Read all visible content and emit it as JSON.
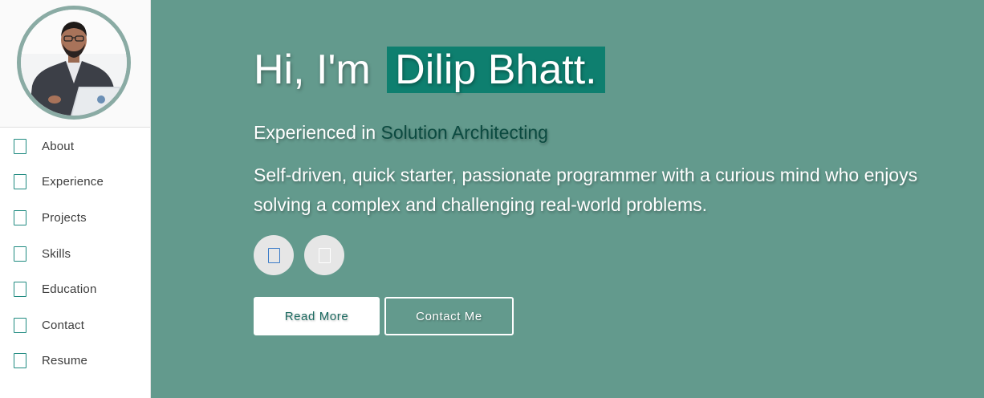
{
  "sidebar": {
    "avatar_alt": "Dilip Bhatt profile photo",
    "items": [
      {
        "label": "About",
        "icon": "about-icon"
      },
      {
        "label": "Experience",
        "icon": "experience-icon"
      },
      {
        "label": "Projects",
        "icon": "projects-icon"
      },
      {
        "label": "Skills",
        "icon": "skills-icon"
      },
      {
        "label": "Education",
        "icon": "education-icon"
      },
      {
        "label": "Contact",
        "icon": "contact-icon"
      },
      {
        "label": "Resume",
        "icon": "resume-icon"
      }
    ]
  },
  "hero": {
    "greeting": "Hi, I'm",
    "name": "Dilip Bhatt.",
    "experience_prefix": "Experienced in",
    "experience_role": "Solution Architecting",
    "bio": "Self-driven, quick starter, passionate programmer with a curious mind who enjoys solving a complex and challenging real-world problems.",
    "socials": [
      {
        "icon": "linkedin-icon"
      },
      {
        "icon": "github-icon"
      }
    ],
    "read_more_label": "Read More",
    "contact_me_label": "Contact Me"
  },
  "colors": {
    "hero_background": "#639a8d",
    "name_highlight": "#0e7f6f",
    "role_text": "#0b4a40",
    "nav_icon": "#1f8a80"
  }
}
